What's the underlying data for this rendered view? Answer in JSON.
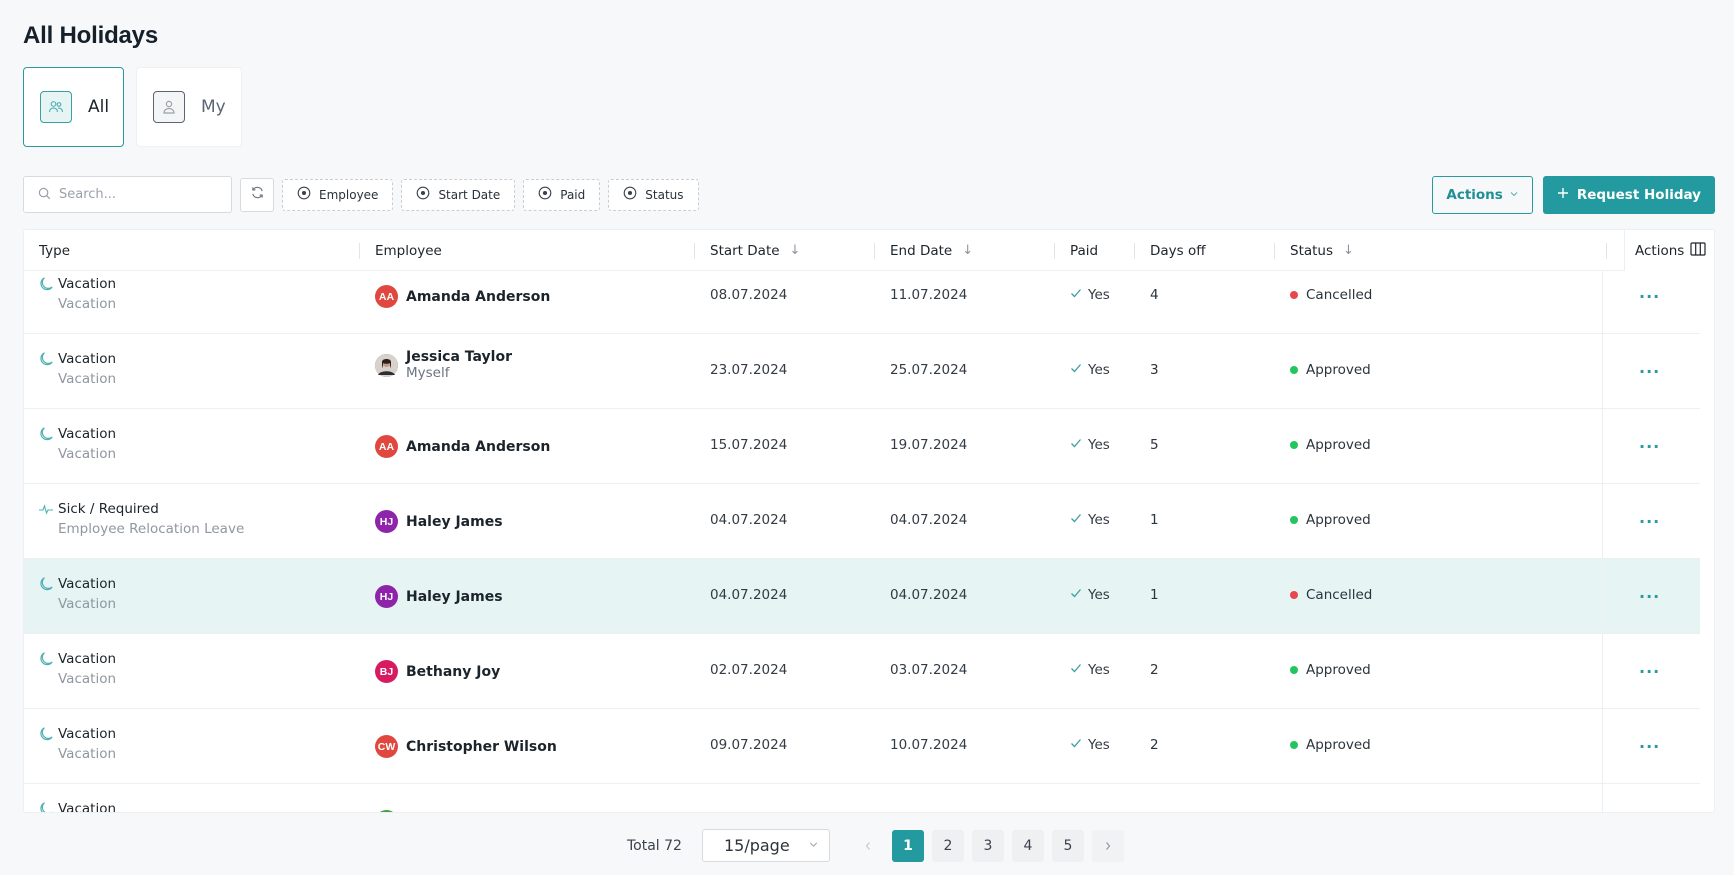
{
  "page": {
    "title": "All Holidays"
  },
  "view_tabs": [
    {
      "label": "All",
      "icon": "users-icon",
      "active": true
    },
    {
      "label": "My",
      "icon": "user-icon",
      "active": false
    }
  ],
  "toolbar": {
    "search_placeholder": "Search...",
    "filters": [
      "Employee",
      "Start Date",
      "Paid",
      "Status"
    ],
    "actions_label": "Actions",
    "request_label": "Request Holiday"
  },
  "table": {
    "columns": {
      "type": "Type",
      "employee": "Employee",
      "start_date": "Start Date",
      "end_date": "End Date",
      "paid": "Paid",
      "days_off": "Days off",
      "status": "Status",
      "actions": "Actions"
    },
    "rows": [
      {
        "type": "Vacation",
        "subtype": "Vacation",
        "type_icon": "moon-icon",
        "employee": "Amanda Anderson",
        "employee_sub": "",
        "initials": "AA",
        "avatar_color": "#e0473f",
        "start": "08.07.2024",
        "end": "11.07.2024",
        "paid": "Yes",
        "days": "4",
        "status": "Cancelled",
        "status_color": "#e5484d",
        "highlight": false
      },
      {
        "type": "Vacation",
        "subtype": "Vacation",
        "type_icon": "moon-icon",
        "employee": "Jessica Taylor",
        "employee_sub": "Myself",
        "initials": "",
        "avatar_color": "#6b5a52",
        "photo": true,
        "start": "23.07.2024",
        "end": "25.07.2024",
        "paid": "Yes",
        "days": "3",
        "status": "Approved",
        "status_color": "#22c55e",
        "highlight": false
      },
      {
        "type": "Vacation",
        "subtype": "Vacation",
        "type_icon": "moon-icon",
        "employee": "Amanda Anderson",
        "employee_sub": "",
        "initials": "AA",
        "avatar_color": "#e0473f",
        "start": "15.07.2024",
        "end": "19.07.2024",
        "paid": "Yes",
        "days": "5",
        "status": "Approved",
        "status_color": "#22c55e",
        "highlight": false
      },
      {
        "type": "Sick / Required",
        "subtype": "Employee Relocation Leave",
        "type_icon": "pulse-icon",
        "employee": "Haley James",
        "employee_sub": "",
        "initials": "HJ",
        "avatar_color": "#8e24aa",
        "start": "04.07.2024",
        "end": "04.07.2024",
        "paid": "Yes",
        "days": "1",
        "status": "Approved",
        "status_color": "#22c55e",
        "highlight": false
      },
      {
        "type": "Vacation",
        "subtype": "Vacation",
        "type_icon": "moon-icon",
        "employee": "Haley James",
        "employee_sub": "",
        "initials": "HJ",
        "avatar_color": "#8e24aa",
        "start": "04.07.2024",
        "end": "04.07.2024",
        "paid": "Yes",
        "days": "1",
        "status": "Cancelled",
        "status_color": "#e5484d",
        "highlight": true
      },
      {
        "type": "Vacation",
        "subtype": "Vacation",
        "type_icon": "moon-icon",
        "employee": "Bethany Joy",
        "employee_sub": "",
        "initials": "BJ",
        "avatar_color": "#d81b60",
        "start": "02.07.2024",
        "end": "03.07.2024",
        "paid": "Yes",
        "days": "2",
        "status": "Approved",
        "status_color": "#22c55e",
        "highlight": false
      },
      {
        "type": "Vacation",
        "subtype": "Vacation",
        "type_icon": "moon-icon",
        "employee": "Christopher Wilson",
        "employee_sub": "",
        "initials": "CW",
        "avatar_color": "#e0473f",
        "start": "09.07.2024",
        "end": "10.07.2024",
        "paid": "Yes",
        "days": "2",
        "status": "Approved",
        "status_color": "#22c55e",
        "highlight": false
      },
      {
        "type": "Vacation",
        "subtype": "",
        "type_icon": "moon-icon",
        "employee": "",
        "employee_sub": "",
        "initials": "",
        "avatar_color": "#43a047",
        "start": "",
        "end": "",
        "paid": "",
        "days": "",
        "status": "",
        "status_color": "#22c55e",
        "highlight": false
      }
    ]
  },
  "pagination": {
    "total_label": "Total 72",
    "page_size": "15/page",
    "pages": [
      "1",
      "2",
      "3",
      "4",
      "5"
    ],
    "current_page": "1"
  },
  "colors": {
    "accent": "#229a9f",
    "approved": "#22c55e",
    "cancelled": "#e5484d"
  }
}
